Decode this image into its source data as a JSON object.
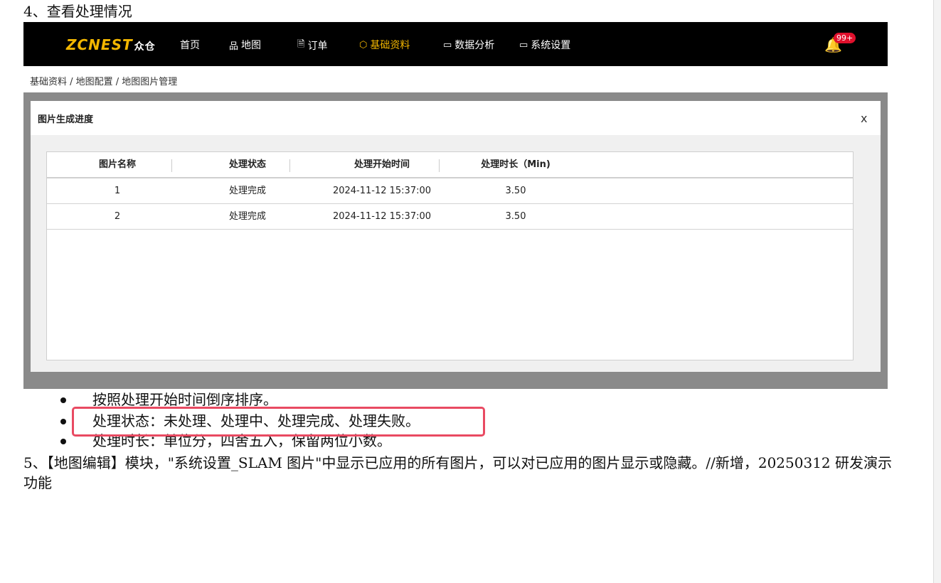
{
  "heading": "4、查看处理情况",
  "topbar": {
    "logo": "ZCNEST",
    "logo_cn": "众仓",
    "nav": [
      {
        "label": "首页",
        "icon": ""
      },
      {
        "label": "地图",
        "icon": "品"
      },
      {
        "label": "订单",
        "icon": "🗎"
      },
      {
        "label": "基础资料",
        "icon": "⬡"
      },
      {
        "label": "数据分析",
        "icon": "▭"
      },
      {
        "label": "系统设置",
        "icon": "▭"
      }
    ],
    "active_index": 3,
    "badge": "99+",
    "accent_color": "#f2b600"
  },
  "breadcrumb": "基础资料 / 地图配置 / 地图图片管理",
  "modal": {
    "title": "图片生成进度",
    "close": "x",
    "headers": [
      "图片名称",
      "处理状态",
      "处理开始时间",
      "处理时长（Min)"
    ],
    "rows": [
      [
        "1",
        "处理完成",
        "2024-11-12 15:37:00",
        "3.50"
      ],
      [
        "2",
        "处理完成",
        "2024-11-12 15:37:00",
        "3.50"
      ]
    ]
  },
  "bullets": [
    "按照处理开始时间倒序排序。",
    "处理状态：未处理、处理中、处理完成、处理失败。",
    "处理时长：单位分，四舍五入，保留两位小数。"
  ],
  "para5": "5、【地图编辑】模块，\"系统设置_SLAM 图片\"中显示已应用的所有图片，可以对已应用的图片显示或隐藏。//新增，20250312 研发演示功能"
}
